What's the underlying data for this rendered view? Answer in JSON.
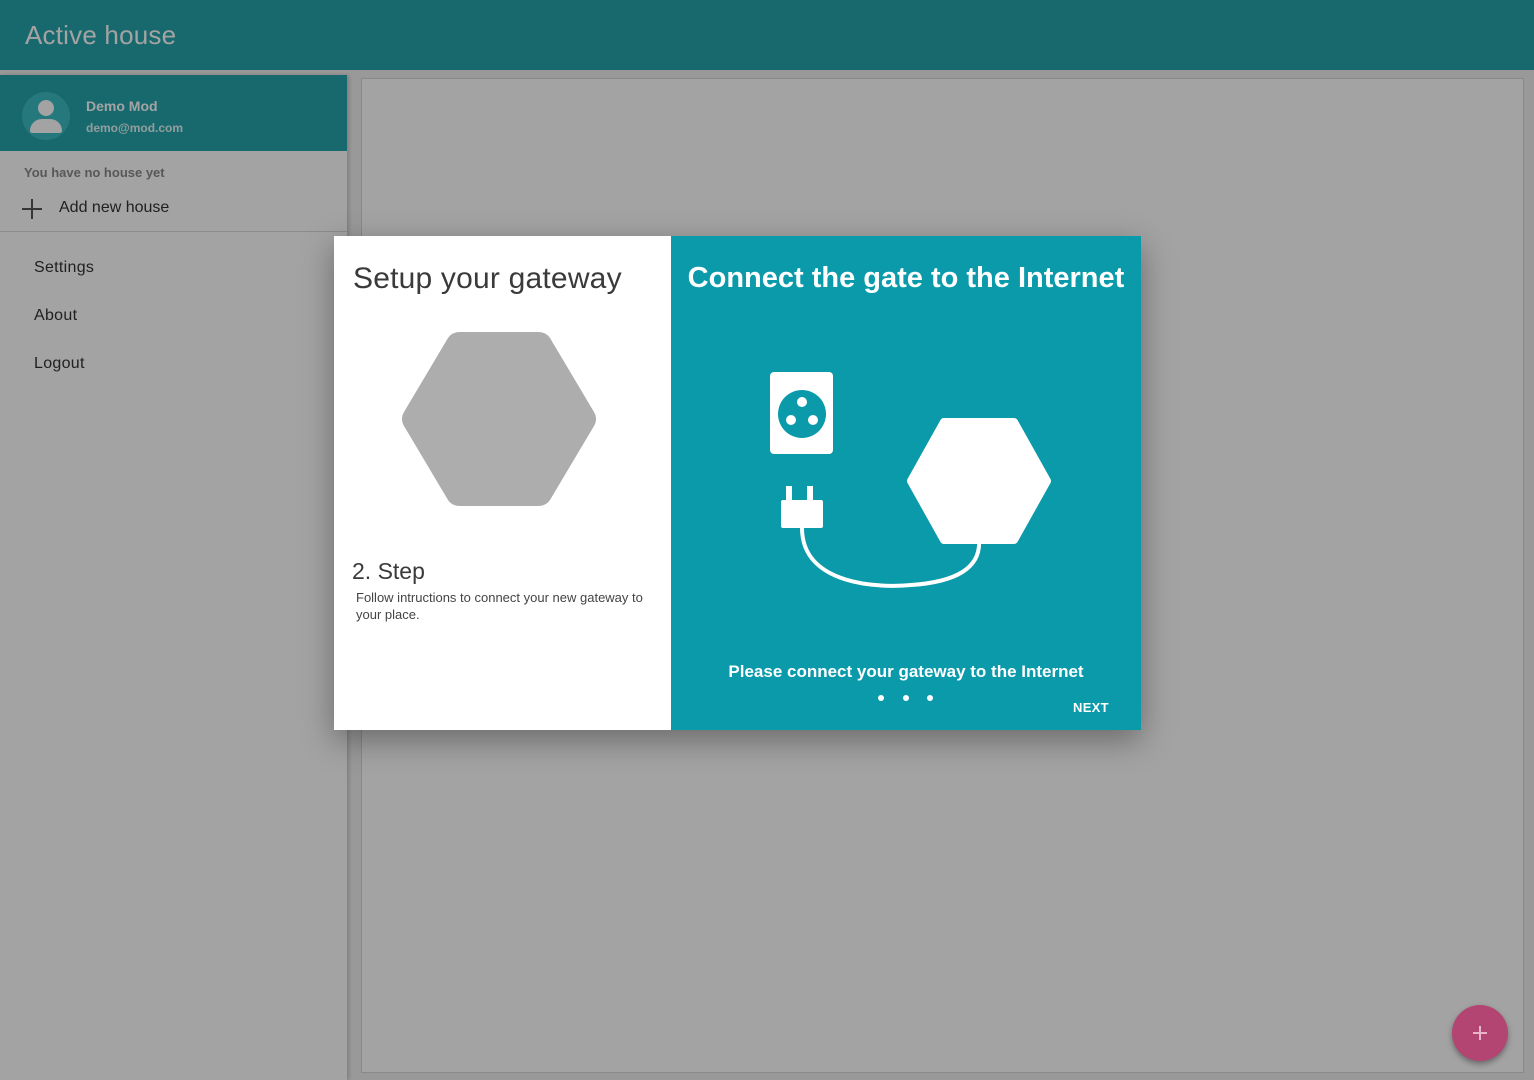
{
  "app": {
    "title": "Active house",
    "primary_color": "#26a5ac",
    "accent_color": "#b24571"
  },
  "drawer": {
    "user": {
      "name": "Demo Mod",
      "email": "demo@mod.com",
      "avatar_icon": "account-icon"
    },
    "no_house_text": "You have no house yet",
    "add_house_label": "Add new house",
    "add_house_icon": "plus-icon",
    "menu": [
      {
        "label": "Settings"
      },
      {
        "label": "About"
      },
      {
        "label": "Logout"
      }
    ]
  },
  "dialog": {
    "title": "Setup your gateway",
    "gateway_icon": "hexagon-gateway-icon",
    "step_title": "2. Step",
    "step_description": "Follow intructions to connect your new gateway to your place.",
    "panel_color": "#0a9aaa",
    "connect_title": "Connect the gate to the Internet",
    "illustration_icons": [
      "power-socket-icon",
      "power-plug-icon",
      "hexagon-gateway-icon"
    ],
    "connect_message": "Please connect your gateway to the Internet",
    "pager": {
      "total": 3
    },
    "next_label": "NEXT"
  },
  "fab": {
    "icon": "plus-icon"
  }
}
